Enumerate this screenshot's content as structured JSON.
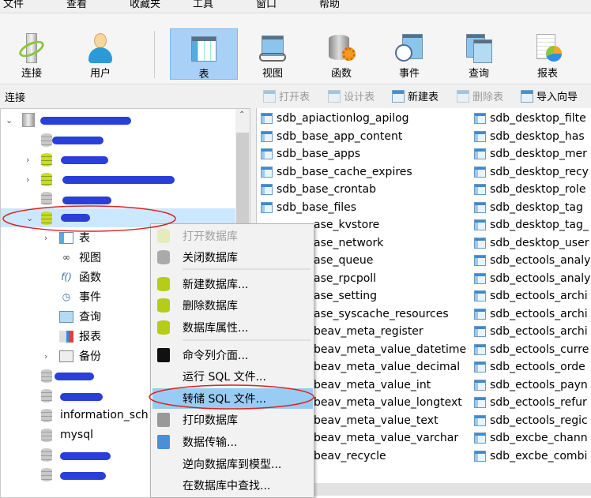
{
  "menubar": [
    "文件",
    "查看",
    "收藏夹",
    "工具",
    "窗口",
    "帮助"
  ],
  "toolbar": {
    "items": [
      {
        "label": "连接",
        "icon": "connection-icon"
      },
      {
        "label": "用户",
        "icon": "user-icon"
      },
      {
        "label": "表",
        "icon": "table-icon",
        "selected": true
      },
      {
        "label": "视图",
        "icon": "view-icon"
      },
      {
        "label": "函数",
        "icon": "function-icon"
      },
      {
        "label": "事件",
        "icon": "event-icon"
      },
      {
        "label": "查询",
        "icon": "query-icon"
      },
      {
        "label": "报表",
        "icon": "report-icon"
      }
    ]
  },
  "panel": {
    "title": "连接"
  },
  "object_toolbar": [
    {
      "label": "打开表",
      "enabled": false
    },
    {
      "label": "设计表",
      "enabled": false
    },
    {
      "label": "新建表",
      "enabled": true
    },
    {
      "label": "删除表",
      "enabled": false
    },
    {
      "label": "导入向导",
      "enabled": true
    }
  ],
  "tree": {
    "subitems": [
      "表",
      "视图",
      "函数",
      "事件",
      "查询",
      "报表",
      "备份"
    ],
    "visible_dbs": [
      "information_sch",
      "mysql"
    ]
  },
  "tables": {
    "col1": [
      "sdb_apiactionlog_apilog",
      "sdb_base_app_content",
      "sdb_base_apps",
      "sdb_base_cache_expires",
      "sdb_base_crontab",
      "sdb_base_files",
      "ase_kvstore",
      "ase_network",
      "ase_queue",
      "ase_rpcpoll",
      "ase_setting",
      "ase_syscache_resources",
      "beav_meta_register",
      "beav_meta_value_datetime",
      "beav_meta_value_decimal",
      "beav_meta_value_int",
      "beav_meta_value_longtext",
      "beav_meta_value_text",
      "beav_meta_value_varchar",
      "beav_recycle"
    ],
    "col2": [
      "sdb_desktop_filte",
      "sdb_desktop_has",
      "sdb_desktop_mer",
      "sdb_desktop_recy",
      "sdb_desktop_role",
      "sdb_desktop_tag",
      "sdb_desktop_tag_",
      "sdb_desktop_user",
      "sdb_ectools_analy",
      "sdb_ectools_analy",
      "sdb_ectools_archi",
      "sdb_ectools_archi",
      "sdb_ectools_archi",
      "sdb_ectools_curre",
      "sdb_ectools_orde",
      "sdb_ectools_payn",
      "sdb_ectools_refur",
      "sdb_ectools_regic",
      "sdb_excbe_chann",
      "sdb_excbe_combi"
    ]
  },
  "context_menu": [
    {
      "label": "打开数据库",
      "enabled": false
    },
    {
      "label": "关闭数据库"
    },
    {
      "label": "新建数据库..."
    },
    {
      "label": "删除数据库"
    },
    {
      "label": "数据库属性..."
    },
    {
      "label": "命令列介面..."
    },
    {
      "label": "运行 SQL 文件..."
    },
    {
      "label": "转储 SQL 文件...",
      "highlighted": true
    },
    {
      "label": "打印数据库"
    },
    {
      "label": "数据传输..."
    },
    {
      "label": "逆向数据库到模型..."
    },
    {
      "label": "在数据库中查找..."
    }
  ],
  "colors": {
    "selection": "#cce8ff",
    "menu_highlight": "#99ccf5",
    "annotation": "#e0201f",
    "toolbar_selected": "#a9d1f7"
  }
}
